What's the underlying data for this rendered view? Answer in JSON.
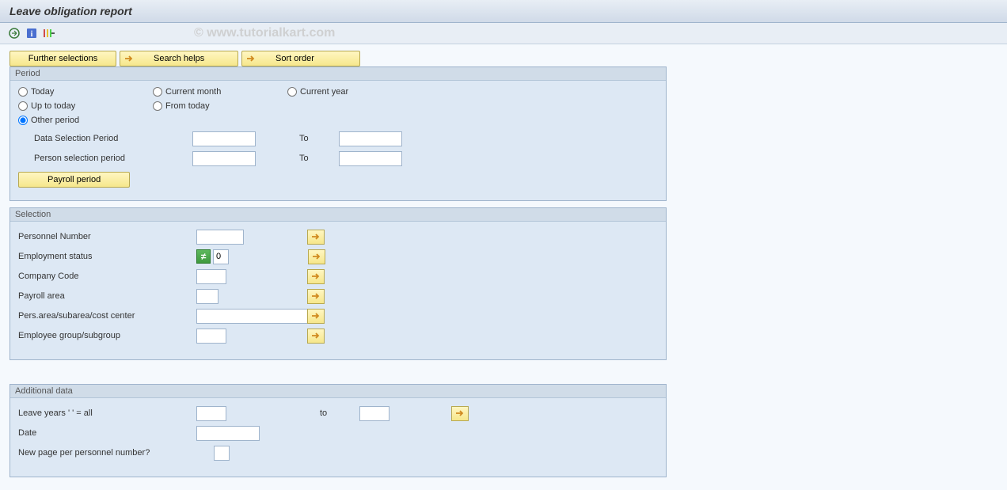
{
  "title": "Leave obligation report",
  "watermark": "© www.tutorialkart.com",
  "top_buttons": {
    "further_selections": "Further selections",
    "search_helps": "Search helps",
    "sort_order": "Sort order"
  },
  "period": {
    "legend": "Period",
    "radios": {
      "today": "Today",
      "current_month": "Current month",
      "current_year": "Current year",
      "up_to_today": "Up to today",
      "from_today": "From today",
      "other_period": "Other period"
    },
    "data_selection_label": "Data Selection Period",
    "person_selection_label": "Person selection period",
    "to_label": "To",
    "payroll_button": "Payroll period"
  },
  "selection": {
    "legend": "Selection",
    "personnel_number": "Personnel Number",
    "employment_status": "Employment status",
    "employment_status_value": "0",
    "company_code": "Company Code",
    "payroll_area": "Payroll area",
    "pers_area": "Pers.area/subarea/cost center",
    "employee_group": "Employee group/subgroup"
  },
  "additional": {
    "legend": "Additional data",
    "leave_years": "Leave years  ' ' = all",
    "to_label": "to",
    "date": "Date",
    "new_page": "New page per personnel number?"
  }
}
